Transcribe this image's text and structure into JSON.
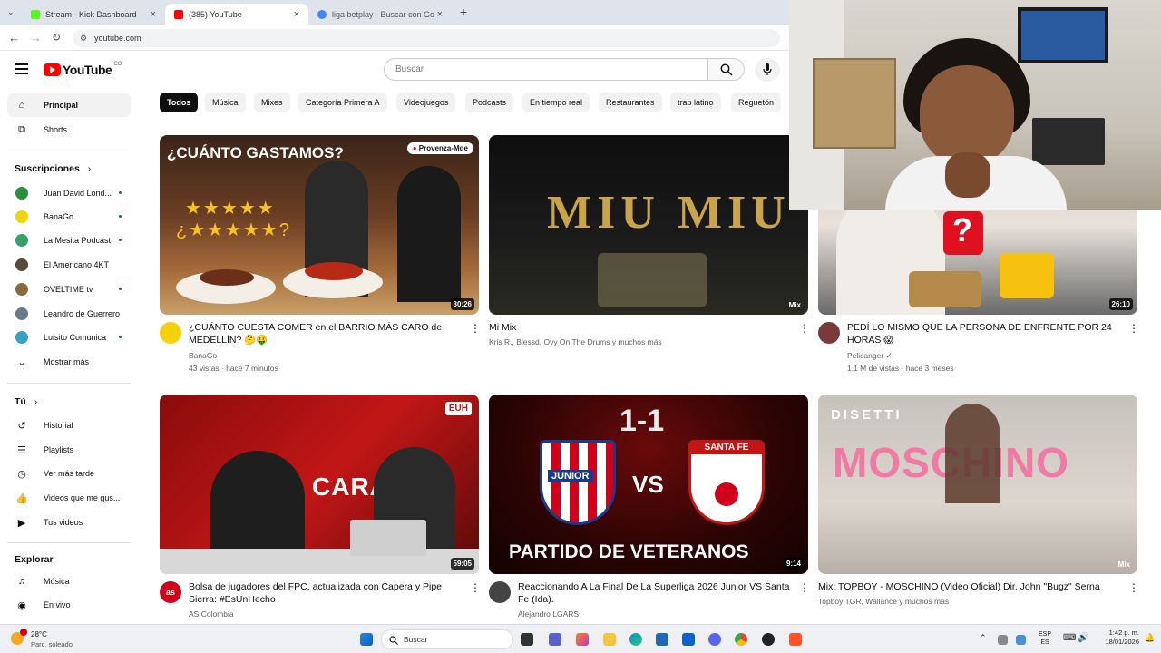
{
  "browser": {
    "tabs": [
      {
        "title": "Stream - Kick Dashboard",
        "favicon_color": "#53fc18"
      },
      {
        "title": "(385) YouTube",
        "favicon_color": "#ff0000"
      },
      {
        "title": "liga betplay - Buscar con Google",
        "favicon_color": "#4285f4"
      }
    ],
    "new_tab": "+",
    "close": "×",
    "url": "youtube.com"
  },
  "header": {
    "logo": "YouTube",
    "country": "CO",
    "search_placeholder": "Buscar"
  },
  "sidebar": {
    "main": [
      {
        "label": "Principal",
        "icon": "home-icon"
      },
      {
        "label": "Shorts",
        "icon": "shorts-icon"
      }
    ],
    "subscriptions_title": "Suscripciones",
    "subscriptions": [
      {
        "label": "Juan David Lond...",
        "color": "#2a8f3a"
      },
      {
        "label": "BanaGo",
        "color": "#f4d20b"
      },
      {
        "label": "La Mesita Podcast",
        "color": "#3a9f6a"
      },
      {
        "label": "El Americano 4KT",
        "color": "#5a4a3a"
      },
      {
        "label": "OVELTIME tv",
        "color": "#8a6a3a"
      },
      {
        "label": "Leandro de Guerrero",
        "color": "#6a7a8a"
      },
      {
        "label": "Luisito Comunica",
        "color": "#3aa0c0"
      }
    ],
    "show_more": "Mostrar más",
    "you_title": "Tú",
    "you": [
      {
        "label": "Historial",
        "icon": "history-icon"
      },
      {
        "label": "Playlists",
        "icon": "playlists-icon"
      },
      {
        "label": "Ver más tarde",
        "icon": "watch-later-icon"
      },
      {
        "label": "Videos que me gus...",
        "icon": "like-icon"
      },
      {
        "label": "Tus videos",
        "icon": "your-videos-icon"
      }
    ],
    "explore_title": "Explorar",
    "explore": [
      {
        "label": "Música",
        "icon": "music-icon"
      },
      {
        "label": "En vivo",
        "icon": "live-icon"
      }
    ]
  },
  "chips": [
    "Todos",
    "Música",
    "Mixes",
    "Categoría Primera A",
    "Videojuegos",
    "Podcasts",
    "En tiempo real",
    "Restaurantes",
    "trap latino",
    "Reguetón"
  ],
  "videos": [
    {
      "title": "¿CUÁNTO CUESTA COMER en el BARRIO MÁS CARO de MEDELLÍN? 🤔🤑",
      "channel": "BanaGo",
      "meta": "43 vistas · hace 7 minutos",
      "duration": "30:26",
      "thumb_text": "¿CUÁNTO GASTAMOS?",
      "thumb_tag": "Provenza-Mde",
      "avatar_color": "#f4d20b"
    },
    {
      "title": "Mi Mix",
      "channel": "Kris R., Blessd, Ovy On The Drums y muchos más",
      "meta": "",
      "duration": "Mix",
      "thumb_text": "MIU MIU",
      "avatar_color": ""
    },
    {
      "title": "PEDÍ LO MISMO QUE LA PERSONA DE ENFRENTE POR 24 HORAS 😱",
      "channel": "Pelicanger ✓",
      "meta": "1.1 M de vistas · hace 3 meses",
      "duration": "26:10",
      "thumb_text": "?",
      "avatar_color": "#7a3a3a"
    },
    {
      "title": "Bolsa de jugadores del FPC, actualizada con Capera y Pipe Sierra: #EsUnHecho",
      "channel": "AS Colombia",
      "meta": "",
      "duration": "59:05",
      "thumb_text": "CARAC",
      "thumb_tag": "EUH",
      "avatar_color": "#d0021b",
      "avatar_text": "as"
    },
    {
      "title": "Reaccionando A La Final De La Superliga 2026 Junior VS Santa Fe (Ida).",
      "channel": "Alejandro LGARS",
      "meta": "",
      "duration": "9:14",
      "thumb_text": "PARTIDO DE VETERANOS",
      "score": "1-1",
      "team_a": "JUNIOR",
      "team_b": "SANTA FE",
      "vs": "VS",
      "avatar_color": "#444"
    },
    {
      "title": "Mix: TOPBOY - MOSCHINO (Video Oficial) Dir. John \"Bugz\" Serna",
      "channel": "Topboy TGR, Wallance y muchos más",
      "meta": "",
      "duration": "Mix",
      "thumb_text": "MOSCHINO",
      "thumb_tag": "DISETTI",
      "avatar_color": ""
    }
  ],
  "taskbar": {
    "weather_temp": "28°C",
    "weather_desc": "Parc. soleado",
    "search": "Buscar",
    "lang": "ESP",
    "lang2": "ES",
    "time": "1:42 p. m.",
    "date": "18/01/2026"
  }
}
